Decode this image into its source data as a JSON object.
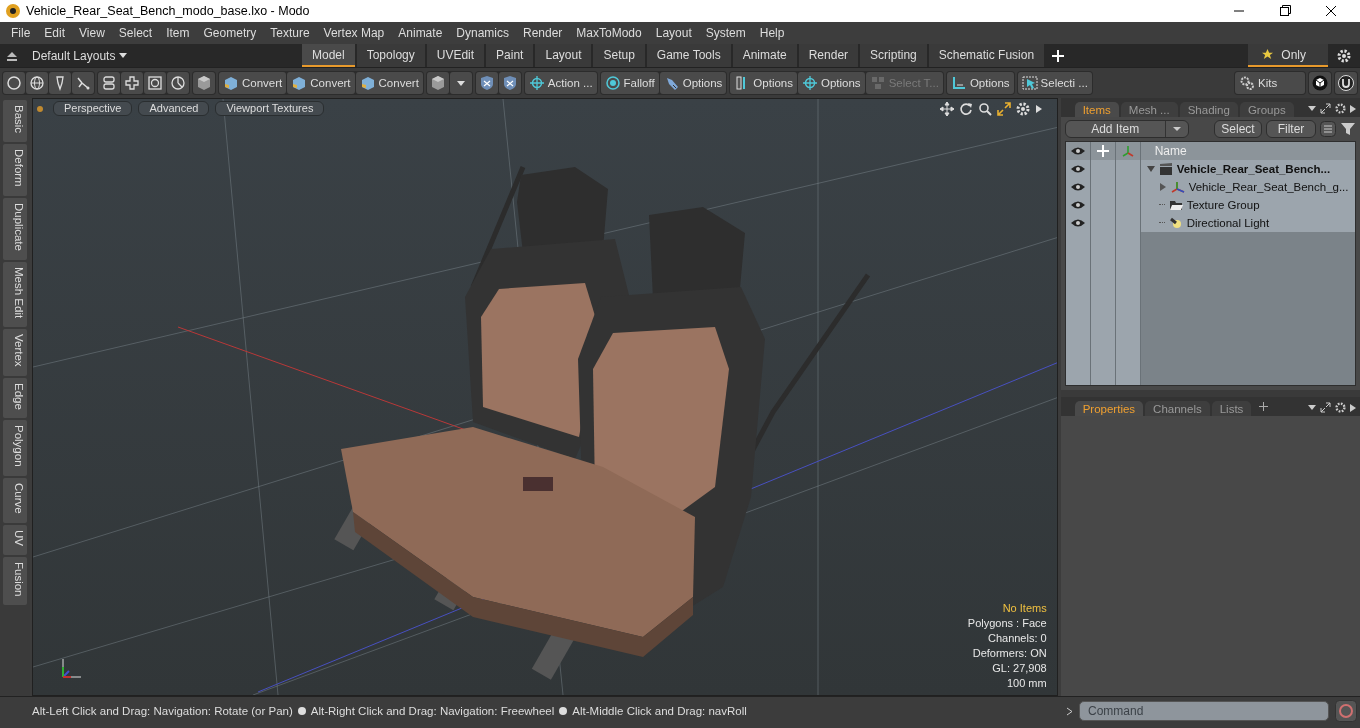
{
  "window": {
    "title": "Vehicle_Rear_Seat_Bench_modo_base.lxo - Modo"
  },
  "menu": [
    "File",
    "Edit",
    "View",
    "Select",
    "Item",
    "Geometry",
    "Texture",
    "Vertex Map",
    "Animate",
    "Dynamics",
    "Render",
    "MaxToModo",
    "Layout",
    "System",
    "Help"
  ],
  "layout_bar": {
    "layouts_label": "Default Layouts",
    "tabs": [
      {
        "label": "Model",
        "selected": true
      },
      {
        "label": "Topology",
        "selected": false
      },
      {
        "label": "UVEdit",
        "selected": false
      },
      {
        "label": "Paint",
        "selected": false
      },
      {
        "label": "Layout",
        "selected": false
      },
      {
        "label": "Setup",
        "selected": false
      },
      {
        "label": "Game Tools",
        "selected": false
      },
      {
        "label": "Animate",
        "selected": false
      },
      {
        "label": "Render",
        "selected": false
      },
      {
        "label": "Scripting",
        "selected": false
      },
      {
        "label": "Schematic Fusion",
        "selected": false
      }
    ],
    "only": {
      "label": "Only",
      "selected": true
    }
  },
  "toolbar": {
    "groups": [
      {
        "items": [
          {
            "kind": "circle"
          },
          {
            "kind": "globe"
          },
          {
            "kind": "pen"
          },
          {
            "kind": "lasso"
          }
        ]
      },
      {
        "items": [
          {
            "kind": "bridge"
          },
          {
            "kind": "cross"
          },
          {
            "kind": "ring"
          },
          {
            "kind": "pie"
          }
        ]
      },
      {
        "items": [
          {
            "kind": "cube"
          }
        ]
      },
      {
        "items": [
          {
            "kind": "convert",
            "label": "Convert"
          },
          {
            "kind": "convert",
            "label": "Convert"
          },
          {
            "kind": "convert",
            "label": "Convert"
          }
        ]
      },
      {
        "items": [
          {
            "kind": "cube"
          },
          {
            "kind": "caret"
          }
        ]
      },
      {
        "items": [
          {
            "kind": "shield"
          },
          {
            "kind": "shield"
          }
        ]
      },
      {
        "items": [
          {
            "kind": "crosshair",
            "label": "Action ..."
          }
        ]
      },
      {
        "items": [
          {
            "kind": "falloff",
            "label": "Falloff"
          },
          {
            "kind": "brush",
            "label": "Options"
          }
        ]
      },
      {
        "items": [
          {
            "kind": "bar",
            "label": "Options"
          },
          {
            "kind": "crosshair",
            "label": "Options"
          },
          {
            "kind": "blocks",
            "label": "Select T...",
            "disabled": true
          }
        ]
      },
      {
        "items": [
          {
            "kind": "corner",
            "label": "Options"
          }
        ]
      },
      {
        "items": [
          {
            "kind": "arrow",
            "label": "Selecti ..."
          }
        ]
      },
      {
        "items": [
          {
            "kind": "gears",
            "label": "Kits"
          }
        ]
      },
      {
        "items": [
          {
            "kind": "cube-badge"
          }
        ]
      },
      {
        "items": [
          {
            "kind": "u-badge"
          }
        ]
      }
    ]
  },
  "side_tabs": [
    "Basic",
    "Deform",
    "Duplicate",
    "Mesh Edit",
    "Vertex",
    "Edge",
    "Polygon",
    "Curve",
    "UV",
    "Fusion"
  ],
  "viewport": {
    "buttons": [
      "Perspective",
      "Advanced",
      "Viewport Textures"
    ],
    "info": {
      "selection": "No Items",
      "lines": [
        "Polygons : Face",
        "Channels: 0",
        "Deformers: ON",
        "GL: 27,908",
        "100 mm"
      ]
    }
  },
  "items_panel": {
    "tabs": [
      {
        "label": "Items",
        "selected": true
      },
      {
        "label": "Mesh ...",
        "selected": false
      },
      {
        "label": "Shading",
        "selected": false
      },
      {
        "label": "Groups",
        "selected": false
      }
    ],
    "add_item": "Add Item",
    "select": "Select",
    "filter": "Filter",
    "columns": [
      "Name"
    ],
    "tree": [
      {
        "name": "Vehicle_Rear_Seat_Bench...",
        "kind": "scene",
        "expanded": true,
        "children": [
          {
            "name": "Vehicle_Rear_Seat_Bench_g...",
            "kind": "mesh",
            "expanded": false
          },
          {
            "name": "Texture Group",
            "kind": "group"
          },
          {
            "name": "Directional Light",
            "kind": "light"
          }
        ]
      }
    ]
  },
  "properties_panel": {
    "tabs": [
      {
        "label": "Properties",
        "selected": true
      },
      {
        "label": "Channels",
        "selected": false
      },
      {
        "label": "Lists",
        "selected": false
      }
    ]
  },
  "status_bar": {
    "hints": [
      "Alt-Left Click and Drag: Navigation: Rotate (or Pan)",
      "Alt-Right Click and Drag: Navigation: Freewheel",
      "Alt-Middle Click and Drag: navRoll"
    ],
    "command_placeholder": "Command"
  }
}
